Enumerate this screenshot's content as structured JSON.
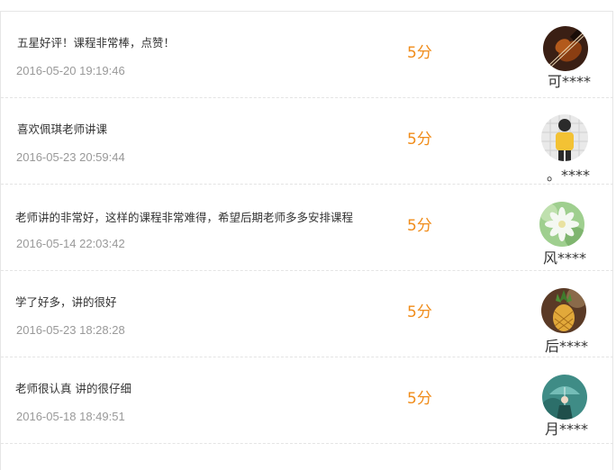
{
  "colors": {
    "score": "#f08c1a",
    "date": "#999999",
    "text": "#333333",
    "divider": "#e4e4e4"
  },
  "reviews": [
    {
      "comment": "五星好评！课程非常棒，点赞！",
      "date": "2016-05-20 19:19:46",
      "score": "5分",
      "user": "可****",
      "avatar_icon": "violin-avatar-icon"
    },
    {
      "comment": "喜欢佩琪老师讲课",
      "date": "2016-05-23 20:59:44",
      "score": "5分",
      "user": "。****",
      "avatar_icon": "person-avatar-icon"
    },
    {
      "comment": "老师讲的非常好，这样的课程非常难得，希望后期老师多多安排课程",
      "date": "2016-05-14 22:03:42",
      "score": "5分",
      "user": "风****",
      "avatar_icon": "flower-avatar-icon"
    },
    {
      "comment": "学了好多，讲的很好",
      "date": "2016-05-23 18:28:28",
      "score": "5分",
      "user": "后****",
      "avatar_icon": "pineapple-drink-avatar-icon"
    },
    {
      "comment": "老师很认真 讲的很仔细",
      "date": "2016-05-18 18:49:51",
      "score": "5分",
      "user": "月****",
      "avatar_icon": "umbrella-girl-avatar-icon"
    }
  ]
}
